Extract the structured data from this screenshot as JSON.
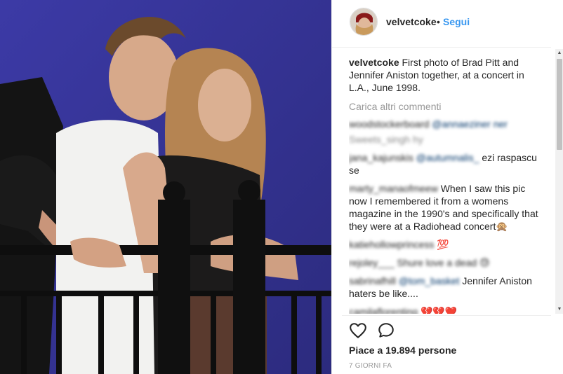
{
  "photo": {
    "alt_icon": "post-photo"
  },
  "header": {
    "username": "velvetcoke",
    "separator": "•",
    "follow_label": "Segui"
  },
  "caption": {
    "username": "velvetcoke",
    "text": "First photo of Brad Pitt and Jennifer Aniston together, at a concert in L.A., June 1998."
  },
  "load_more_label": "Carica altri commenti",
  "comments": [
    {
      "user": "woodstockerboard",
      "mention": "@annaeziner",
      "text": "ner"
    },
    {
      "user": "",
      "mention": "",
      "text": "Sweets_singh hy"
    },
    {
      "user": "jana_kajunskis",
      "mention": "@autumnalis_",
      "text": "ezi raspascu se"
    },
    {
      "user": "marty_manaofmeew",
      "mention": "",
      "text": "When I saw this pic now I remembered it from a womens magazine in the 1990's and specifically that they were at a Radiohead concert🙊"
    },
    {
      "user": "katiehollowprincess",
      "mention": "",
      "text": "💯"
    },
    {
      "user": "rejoley___",
      "mention": "",
      "text": "Shure love a dead 😓"
    },
    {
      "user": "sabrinafhill",
      "mention": "@tom_basket",
      "text": "Jennifer Aniston haters be like...."
    },
    {
      "user": "camilaflorenting",
      "mention": "",
      "text": "💔💔❤️"
    }
  ],
  "actions": {
    "like_icon": "heart-outline-icon",
    "comment_icon": "comment-bubble-icon"
  },
  "likes_text": "Piace a 19.894 persone",
  "time_text": "7 GIORNI FA",
  "colors": {
    "link": "#3897f0",
    "mention": "#003569",
    "muted": "#999999",
    "text": "#262626",
    "photo_bg": "#3a3a9a"
  }
}
